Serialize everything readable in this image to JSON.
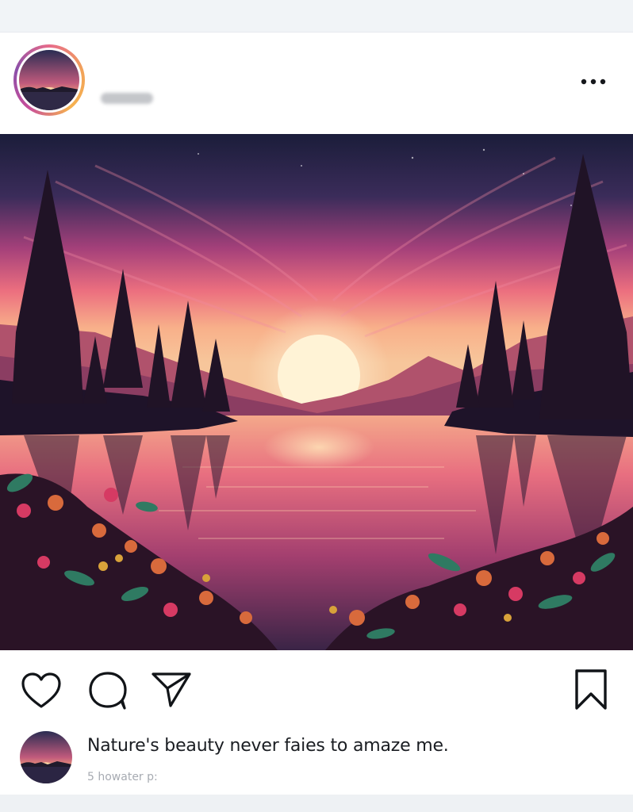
{
  "post": {
    "username": "",
    "caption": "Nature's beauty never faies to amaze me.",
    "subtext": "5 howater p:"
  },
  "icons": {
    "more": "more-horizontal-icon",
    "like": "heart-icon",
    "comment": "comment-bubble-icon",
    "share": "send-paper-plane-icon",
    "save": "bookmark-icon"
  },
  "colors": {
    "text": "#1a1d22",
    "icon": "#111418",
    "subtext": "#a7abb2",
    "avatar_ring": "#e76b8a"
  }
}
